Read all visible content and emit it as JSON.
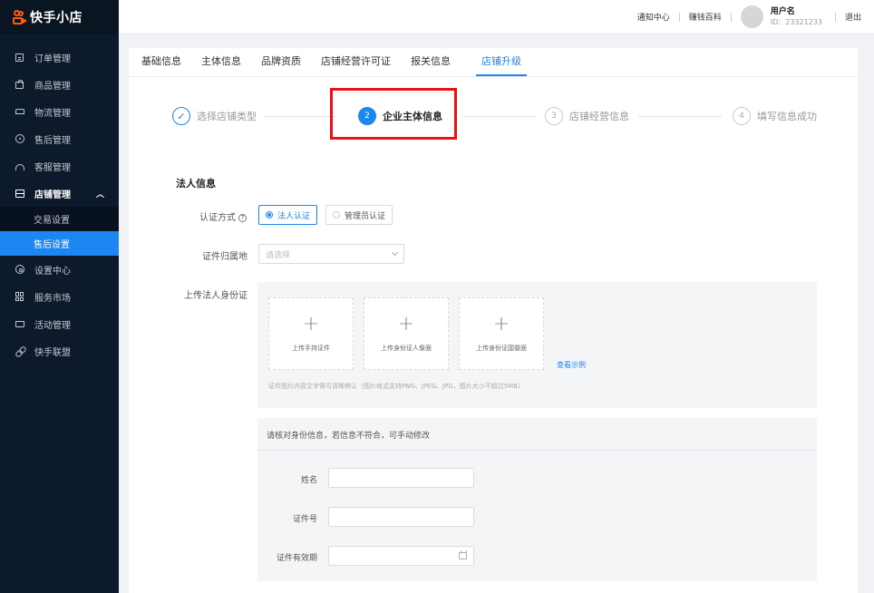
{
  "app": {
    "name": "快手小店"
  },
  "sidebar": {
    "items": [
      {
        "label": "订单管理",
        "icon": "order-icon"
      },
      {
        "label": "商品管理",
        "icon": "bag-icon"
      },
      {
        "label": "物流管理",
        "icon": "truck-icon"
      },
      {
        "label": "售后管理",
        "icon": "aftersale-icon"
      },
      {
        "label": "客服管理",
        "icon": "headset-icon"
      },
      {
        "label": "店铺管理",
        "icon": "store-icon",
        "expanded": true
      }
    ],
    "sub_items": [
      {
        "label": "交易设置"
      },
      {
        "label": "售后设置",
        "active": true
      }
    ],
    "items_after": [
      {
        "label": "设置中心",
        "icon": "gear-icon"
      },
      {
        "label": "服务市场",
        "icon": "grid-icon"
      },
      {
        "label": "活动管理",
        "icon": "ticket-icon"
      },
      {
        "label": "快手联盟",
        "icon": "link-icon"
      }
    ]
  },
  "header": {
    "notice": "通知中心",
    "wiki": "赚钱百科",
    "user_name": "用户名",
    "user_id": "ID：23321233",
    "logout": "退出"
  },
  "tabs": [
    "基础信息",
    "主体信息",
    "品牌资质",
    "店铺经营许可证",
    "报关信息",
    "店铺升级"
  ],
  "active_tab": "店铺升级",
  "steps": [
    {
      "num": "✓",
      "label": "选择店铺类型",
      "state": "done"
    },
    {
      "num": "2",
      "label": "企业主体信息",
      "state": "current"
    },
    {
      "num": "3",
      "label": "店铺经营信息",
      "state": "pending"
    },
    {
      "num": "4",
      "label": "填写信息成功",
      "state": "pending"
    }
  ],
  "form": {
    "section_title": "法人信息",
    "auth_label": "认证方式",
    "auth_options": [
      "法人认证",
      "管理员认证"
    ],
    "auth_selected": "法人认证",
    "region_label": "证件归属地",
    "region_placeholder": "请选择",
    "upload_label": "上传法人身份证",
    "upload_boxes": [
      "上传手持证件",
      "上传身份证人像面",
      "上传身份证国徽面"
    ],
    "example_link": "查看示例",
    "upload_hint": "证件图片内容文字需可清晰辨认（图片格式支持PNG、JPEG、JPG，图片大小不超过5MB）",
    "verify_title": "请核对身份信息，若信息不符合，可手动修改",
    "name_label": "姓名",
    "id_label": "证件号",
    "valid_label": "证件有效期"
  },
  "colors": {
    "accent": "#1e86f0",
    "sidebar_bg": "#0d1a2b",
    "highlight": "#ee1111",
    "brand": "#ff5b0a"
  }
}
